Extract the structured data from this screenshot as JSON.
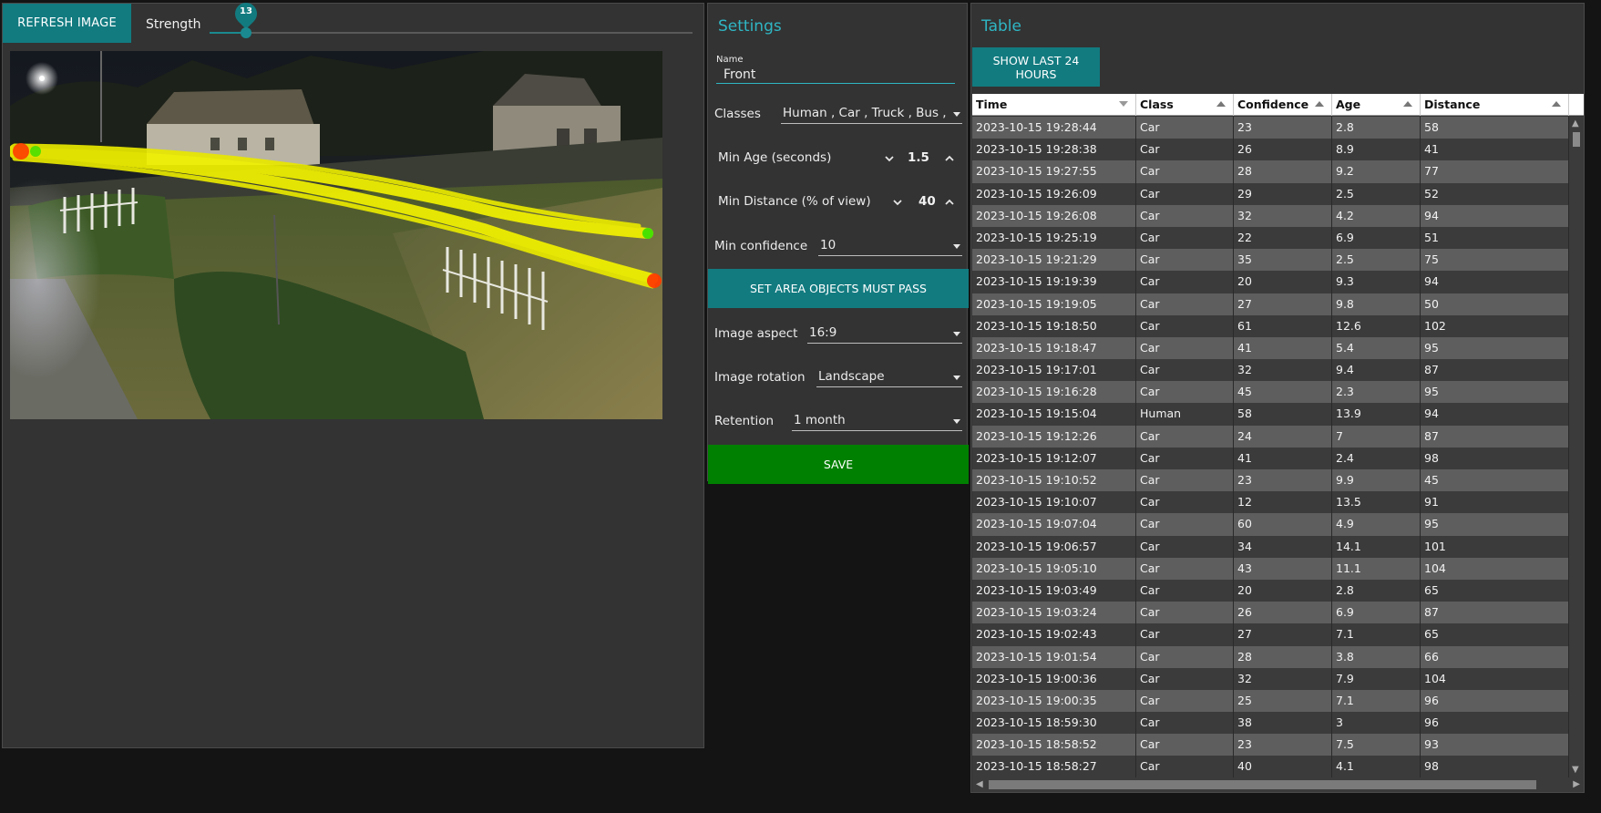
{
  "left": {
    "refresh_label": "REFRESH IMAGE",
    "strength_label": "Strength",
    "strength_value": "13",
    "strength_fraction": 0.075
  },
  "settings": {
    "title": "Settings",
    "name_label": "Name",
    "name_value": "Front",
    "classes_label": "Classes",
    "classes_value": "Human , Car , Truck , Bus , ...",
    "min_age_label": "Min Age (seconds)",
    "min_age_value": "1.5",
    "min_distance_label": "Min Distance (% of view)",
    "min_distance_value": "40",
    "min_confidence_label": "Min confidence",
    "min_confidence_value": "10",
    "set_area_label": "SET AREA OBJECTS MUST PASS",
    "image_aspect_label": "Image aspect",
    "image_aspect_value": "16:9",
    "image_rotation_label": "Image rotation",
    "image_rotation_value": "Landscape",
    "retention_label": "Retention",
    "retention_value": "1 month",
    "save_label": "SAVE"
  },
  "table": {
    "title": "Table",
    "show_label": "SHOW LAST 24 HOURS",
    "columns": [
      "Time",
      "Class",
      "Confidence",
      "Age",
      "Distance"
    ],
    "rows": [
      [
        "2023-10-15 19:28:44",
        "Car",
        "23",
        "2.8",
        "58"
      ],
      [
        "2023-10-15 19:28:38",
        "Car",
        "26",
        "8.9",
        "41"
      ],
      [
        "2023-10-15 19:27:55",
        "Car",
        "28",
        "9.2",
        "77"
      ],
      [
        "2023-10-15 19:26:09",
        "Car",
        "29",
        "2.5",
        "52"
      ],
      [
        "2023-10-15 19:26:08",
        "Car",
        "32",
        "4.2",
        "94"
      ],
      [
        "2023-10-15 19:25:19",
        "Car",
        "22",
        "6.9",
        "51"
      ],
      [
        "2023-10-15 19:21:29",
        "Car",
        "35",
        "2.5",
        "75"
      ],
      [
        "2023-10-15 19:19:39",
        "Car",
        "20",
        "9.3",
        "94"
      ],
      [
        "2023-10-15 19:19:05",
        "Car",
        "27",
        "9.8",
        "50"
      ],
      [
        "2023-10-15 19:18:50",
        "Car",
        "61",
        "12.6",
        "102"
      ],
      [
        "2023-10-15 19:18:47",
        "Car",
        "41",
        "5.4",
        "95"
      ],
      [
        "2023-10-15 19:17:01",
        "Car",
        "32",
        "9.4",
        "87"
      ],
      [
        "2023-10-15 19:16:28",
        "Car",
        "45",
        "2.3",
        "95"
      ],
      [
        "2023-10-15 19:15:04",
        "Human",
        "58",
        "13.9",
        "94"
      ],
      [
        "2023-10-15 19:12:26",
        "Car",
        "24",
        "7",
        "87"
      ],
      [
        "2023-10-15 19:12:07",
        "Car",
        "41",
        "2.4",
        "98"
      ],
      [
        "2023-10-15 19:10:52",
        "Car",
        "23",
        "9.9",
        "45"
      ],
      [
        "2023-10-15 19:10:07",
        "Car",
        "12",
        "13.5",
        "91"
      ],
      [
        "2023-10-15 19:07:04",
        "Car",
        "60",
        "4.9",
        "95"
      ],
      [
        "2023-10-15 19:06:57",
        "Car",
        "34",
        "14.1",
        "101"
      ],
      [
        "2023-10-15 19:05:10",
        "Car",
        "43",
        "11.1",
        "104"
      ],
      [
        "2023-10-15 19:03:49",
        "Car",
        "20",
        "2.8",
        "65"
      ],
      [
        "2023-10-15 19:03:24",
        "Car",
        "26",
        "6.9",
        "87"
      ],
      [
        "2023-10-15 19:02:43",
        "Car",
        "27",
        "7.1",
        "65"
      ],
      [
        "2023-10-15 19:01:54",
        "Car",
        "28",
        "3.8",
        "66"
      ],
      [
        "2023-10-15 19:00:36",
        "Car",
        "32",
        "7.9",
        "104"
      ],
      [
        "2023-10-15 19:00:35",
        "Car",
        "25",
        "7.1",
        "96"
      ],
      [
        "2023-10-15 18:59:30",
        "Car",
        "38",
        "3",
        "96"
      ],
      [
        "2023-10-15 18:58:52",
        "Car",
        "23",
        "7.5",
        "93"
      ],
      [
        "2023-10-15 18:58:27",
        "Car",
        "40",
        "4.1",
        "98"
      ]
    ]
  },
  "colors": {
    "accent_teal": "#127b80",
    "title_teal": "#2fb6c4",
    "save_green": "#008000",
    "panel_bg": "#333333",
    "track_yellow": "#f2f200"
  },
  "icons": [
    "chevron-down-icon",
    "chevron-up-icon",
    "dropdown-caret-icon",
    "sort-icon"
  ]
}
